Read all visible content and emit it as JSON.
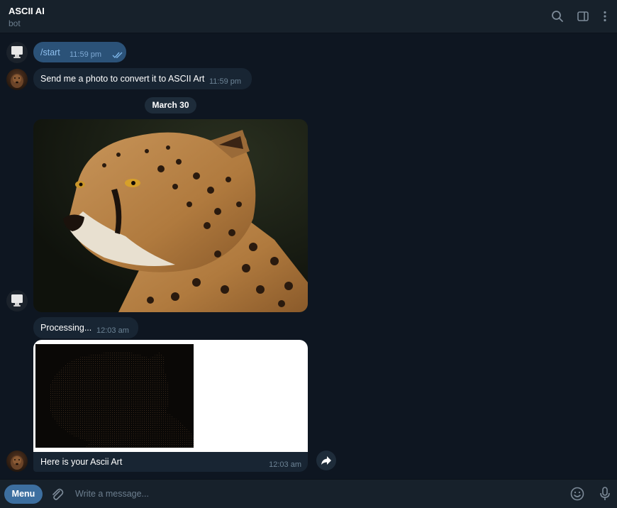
{
  "header": {
    "title": "ASCII AI",
    "subtitle": "bot"
  },
  "messages": {
    "start": {
      "text": "/start",
      "time": "11:59 pm"
    },
    "welcome": {
      "text": "Send me a photo to convert it to ASCII Art",
      "time": "11:59 pm"
    },
    "date_separator": "March 30",
    "processing": {
      "text": "Processing...",
      "time": "12:03 am"
    },
    "ascii_result": {
      "caption": "Here is your Ascii Art",
      "time": "12:03 am"
    }
  },
  "composer": {
    "menu_label": "Menu",
    "placeholder": "Write a message..."
  },
  "colors": {
    "background": "#0e1621",
    "header": "#17212b",
    "outgoing_bubble": "#2b5278",
    "incoming_bubble": "#182533",
    "accent": "#3d6fa0"
  }
}
